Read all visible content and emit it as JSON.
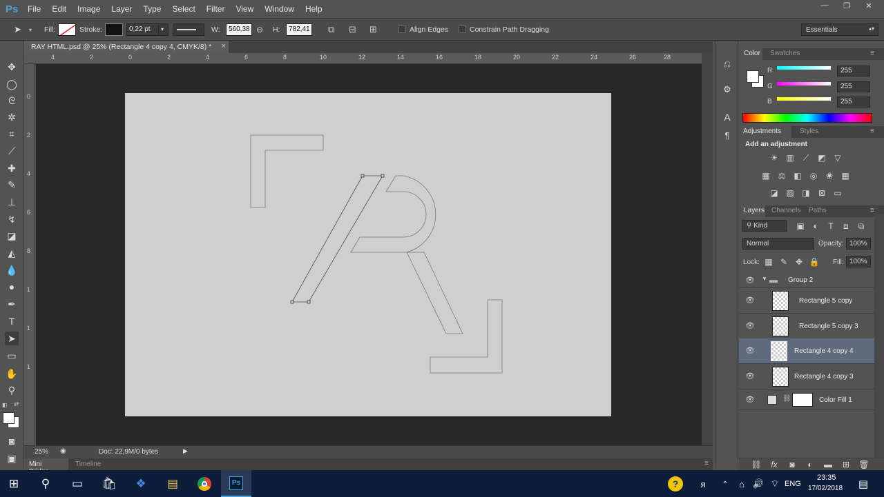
{
  "app": {
    "logo": "Ps"
  },
  "menu": [
    "File",
    "Edit",
    "Image",
    "Layer",
    "Type",
    "Select",
    "Filter",
    "View",
    "Window",
    "Help"
  ],
  "window_controls": {
    "minimize": "—",
    "restore": "❐",
    "close": "✕"
  },
  "options": {
    "fill_label": "Fill:",
    "stroke_label": "Stroke:",
    "stroke_width": "0,22 pt",
    "w_label": "W:",
    "w_value": "560,38",
    "h_label": "H:",
    "h_value": "782,41",
    "align_edges": "Align Edges",
    "constrain_path": "Constrain Path Dragging",
    "workspace": "Essentials"
  },
  "document": {
    "tab_title": "RAY HTML.psd @ 25% (Rectangle 4 copy 4, CMYK/8) *",
    "close": "×",
    "zoom": "25%",
    "doc_info": "Doc: 22,9M/0 bytes",
    "ruler_h": [
      "4",
      "2",
      "0",
      "2",
      "4",
      "6",
      "8",
      "10",
      "12",
      "14",
      "16",
      "18",
      "20",
      "22",
      "24",
      "26",
      "28"
    ],
    "ruler_v": [
      "0",
      "2",
      "4",
      "6",
      "8",
      "1",
      "1",
      "1"
    ],
    "bottom_tabs": [
      "Mini Bridge",
      "Timeline"
    ]
  },
  "color_panel": {
    "tabs": [
      "Color",
      "Swatches"
    ],
    "r_label": "R",
    "g_label": "G",
    "b_label": "B",
    "r": "255",
    "g": "255",
    "b": "255"
  },
  "adjustments_panel": {
    "tabs": [
      "Adjustments",
      "Styles"
    ],
    "heading": "Add an adjustment"
  },
  "layers_panel": {
    "tabs": [
      "Layers",
      "Channels",
      "Paths"
    ],
    "kind": "Kind",
    "blend_mode": "Normal",
    "opacity_label": "Opacity:",
    "opacity": "100%",
    "lock_label": "Lock:",
    "fill_label": "Fill:",
    "fill": "100%",
    "group": "Group 2",
    "layers": [
      {
        "name": "Rectangle 5 copy"
      },
      {
        "name": "Rectangle 5 copy 3"
      },
      {
        "name": "Rectangle 4 copy 4"
      },
      {
        "name": "Rectangle 4 copy 3"
      },
      {
        "name": "Color Fill 1"
      }
    ]
  },
  "taskbar": {
    "lang": "ENG",
    "time": "23:35",
    "date": "17/02/2018"
  },
  "colors": {
    "accent": "#4aa3df",
    "artboard": "#cfcfcf",
    "taskbar": "#0e1d3a"
  }
}
